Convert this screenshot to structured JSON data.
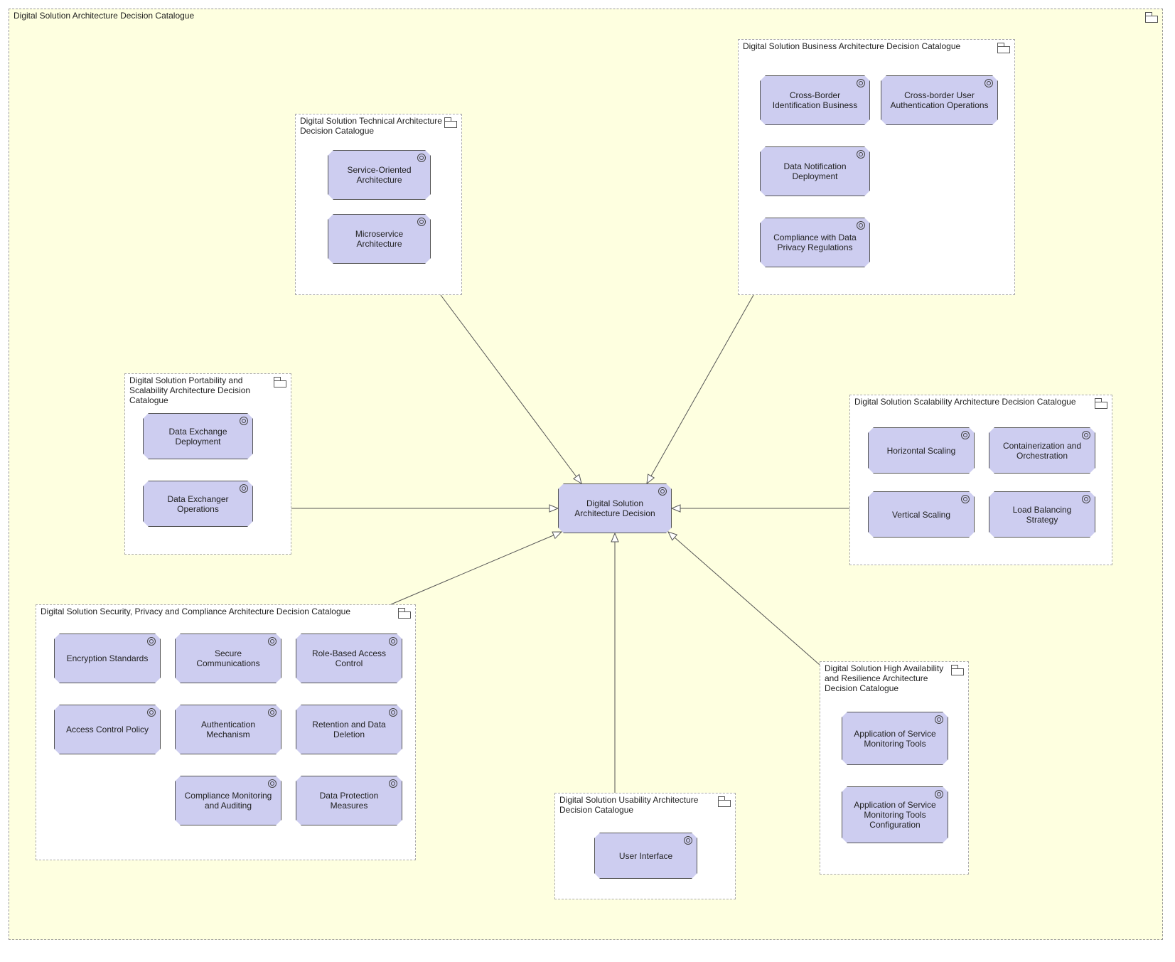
{
  "outer": {
    "title": "Digital Solution Architecture Decision Catalogue"
  },
  "central_node": {
    "label": "Digital Solution Architecture Decision"
  },
  "catalogues": {
    "technical": {
      "title": "Digital Solution Technical Architecture Decision Catalogue",
      "nodes": {
        "soa": "Service-Oriented Architecture",
        "micro": "Microservice Architecture"
      }
    },
    "business": {
      "title": "Digital Solution Business Architecture Decision Catalogue",
      "nodes": {
        "cbib": "Cross-Border Identification Business",
        "cbua": "Cross-border User Authentication Operations",
        "dnd": "Data Notification Deployment",
        "cdpr": "Compliance with Data Privacy Regulations"
      }
    },
    "portability": {
      "title": "Digital Solution Portability and Scalability Architecture Decision Catalogue",
      "nodes": {
        "ded": "Data Exchange Deployment",
        "deo": "Data Exchanger Operations"
      }
    },
    "scalability": {
      "title": "Digital Solution Scalability Architecture Decision Catalogue",
      "nodes": {
        "hs": "Horizontal Scaling",
        "co": "Containerization and Orchestration",
        "vs": "Vertical Scaling",
        "lbs": "Load Balancing Strategy"
      }
    },
    "security": {
      "title": "Digital Solution Security, Privacy and Compliance Architecture Decision Catalogue",
      "nodes": {
        "es": "Encryption Standards",
        "sc": "Secure Communications",
        "rbac": "Role-Based Access Control",
        "acp": "Access Control Policy",
        "am": "Authentication Mechanism",
        "rdd": "Retention and Data Deletion",
        "cma": "Compliance Monitoring and Auditing",
        "dpm": "Data Protection Measures"
      }
    },
    "usability": {
      "title": "Digital Solution Usability Architecture Decision Catalogue",
      "nodes": {
        "ui": "User Interface"
      }
    },
    "ha": {
      "title": "Digital Solution High Availability and Resilience Architecture Decision Catalogue",
      "nodes": {
        "smt": "Application of Service Monitoring Tools",
        "smtc": "Application of Service Monitoring Tools Configuration"
      }
    }
  }
}
